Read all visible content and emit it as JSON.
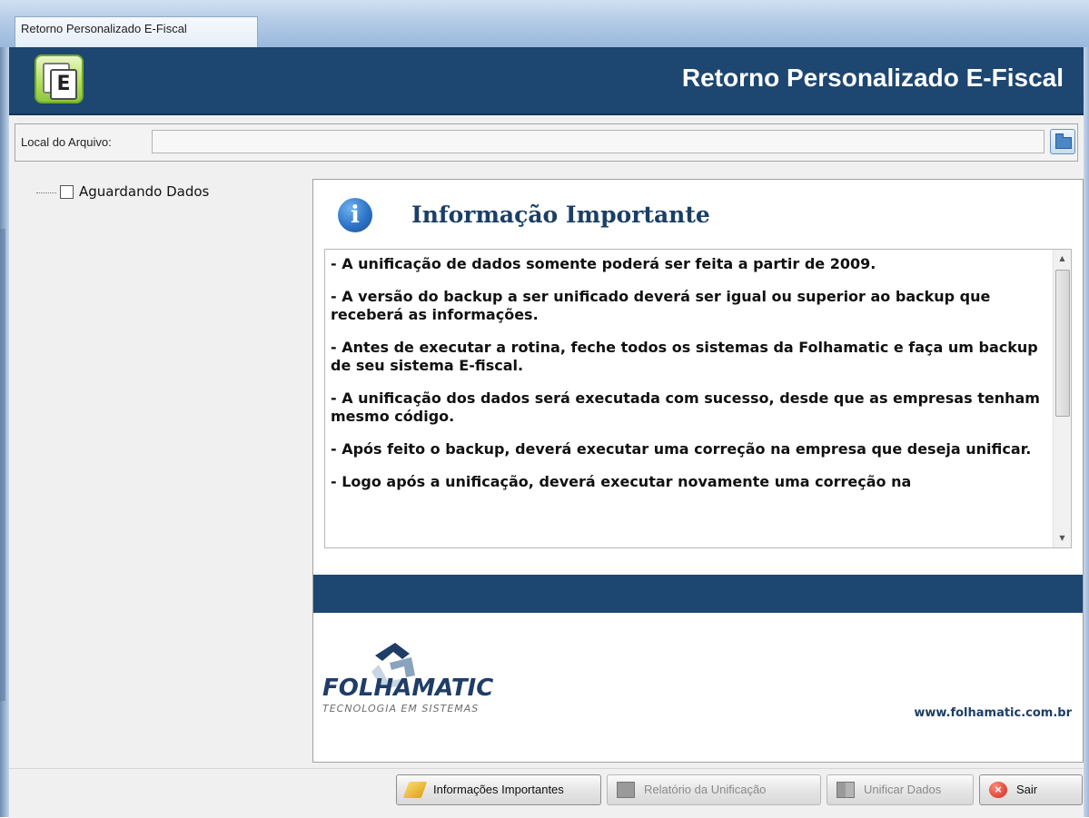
{
  "window": {
    "title": "Retorno Personalizado E-Fiscal"
  },
  "header": {
    "title": "Retorno Personalizado E-Fiscal",
    "logo_icon": "e-fiscal-logo-icon"
  },
  "file_row": {
    "label": "Local do Arquivo:",
    "value": "",
    "browse_icon": "folder-icon"
  },
  "tree": {
    "items": [
      {
        "label": "Aguardando Dados",
        "checked": false
      }
    ]
  },
  "info": {
    "title": "Informação Importante",
    "icon": "info-icon",
    "messages": [
      "- A unificação de dados somente poderá ser feita a partir de 2009.",
      "- A versão do backup a ser unificado deverá ser igual ou superior ao backup que receberá as informações.",
      "- Antes de executar a rotina, feche todos os sistemas da Folhamatic e faça um backup de seu sistema E-fiscal.",
      "- A unificação dos dados será executada com sucesso, desde que as empresas tenham mesmo código.",
      "- Após feito o backup, deverá executar uma correção na empresa que deseja unificar.",
      "- Logo após a unificação, deverá executar novamente uma correção na"
    ]
  },
  "branding": {
    "name": "FOLHAMATIC",
    "tagline": "TECNOLOGIA EM SISTEMAS",
    "website": "www.folhamatic.com.br"
  },
  "toolbar": {
    "info_label": "Informações Importantes",
    "report_label": "Relatório da Unificação",
    "unify_label": "Unificar Dados",
    "exit_label": "Sair"
  },
  "colors": {
    "header_bg": "#1d4670",
    "title_blue": "#1b3f66"
  }
}
